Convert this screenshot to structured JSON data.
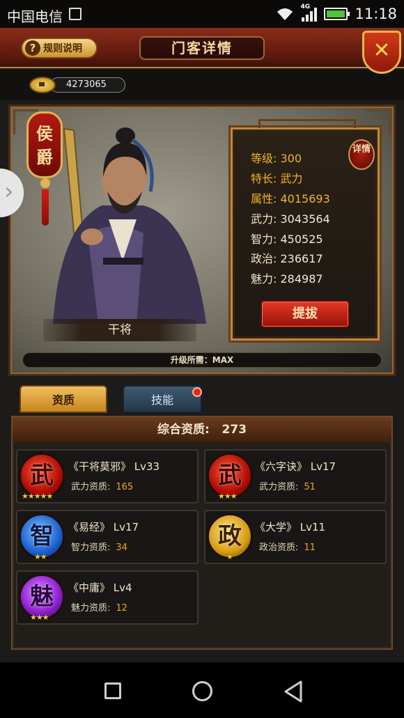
{
  "status_bar": {
    "carrier": "中国电信",
    "network": "4G",
    "time": "11:18"
  },
  "header": {
    "rules_label": "规则说明",
    "title": "门客详情",
    "close_symbol": "✕"
  },
  "currency": {
    "amount": "4273065"
  },
  "hero": {
    "rank": "侯爵",
    "name": "干将",
    "upgrade_text": "升级所需：MAX",
    "detail_badge": "详情",
    "stats": [
      {
        "label": "等级:",
        "value": "300",
        "highlight": true
      },
      {
        "label": "特长:",
        "value": "武力",
        "highlight": true
      },
      {
        "label": "属性:",
        "value": "4015693",
        "highlight": true
      },
      {
        "label": "武力:",
        "value": "3043564",
        "highlight": false
      },
      {
        "label": "智力:",
        "value": "450525",
        "highlight": false
      },
      {
        "label": "政治:",
        "value": "236617",
        "highlight": false
      },
      {
        "label": "魅力:",
        "value": "284987",
        "highlight": false
      }
    ],
    "promote_label": "提拔"
  },
  "tabs": [
    {
      "label": "资质",
      "active": true
    },
    {
      "label": "技能",
      "active": false,
      "has_notification": true
    }
  ],
  "quality": {
    "total_label": "综合资质:",
    "total_value": "273",
    "skills": [
      {
        "icon_char": "武",
        "icon": "wu-martial-icon",
        "stars": "★★★★★",
        "name": "《干将莫邪》 Lv33",
        "attr_label": "武力资质:",
        "attr_value": "165"
      },
      {
        "icon_char": "武",
        "icon": "wu-martial-icon",
        "stars": "★★★",
        "name": "《六字诀》 Lv17",
        "attr_label": "武力资质:",
        "attr_value": "51"
      },
      {
        "icon_char": "智",
        "icon": "zhi-intellect-icon",
        "stars": "★★",
        "name": "《易经》 Lv17",
        "attr_label": "智力资质:",
        "attr_value": "34"
      },
      {
        "icon_char": "政",
        "icon": "zheng-politics-icon",
        "stars": "★",
        "name": "《大学》 Lv11",
        "attr_label": "政治资质:",
        "attr_value": "11"
      },
      {
        "icon_char": "魅",
        "icon": "mei-charm-icon",
        "stars": "★★★",
        "name": "《中庸》 Lv4",
        "attr_label": "魅力资质:",
        "attr_value": "12"
      }
    ]
  },
  "colors": {
    "accent_gold": "#f1b51f",
    "header_red": "#8a2d1a",
    "button_red": "#e23a28"
  }
}
